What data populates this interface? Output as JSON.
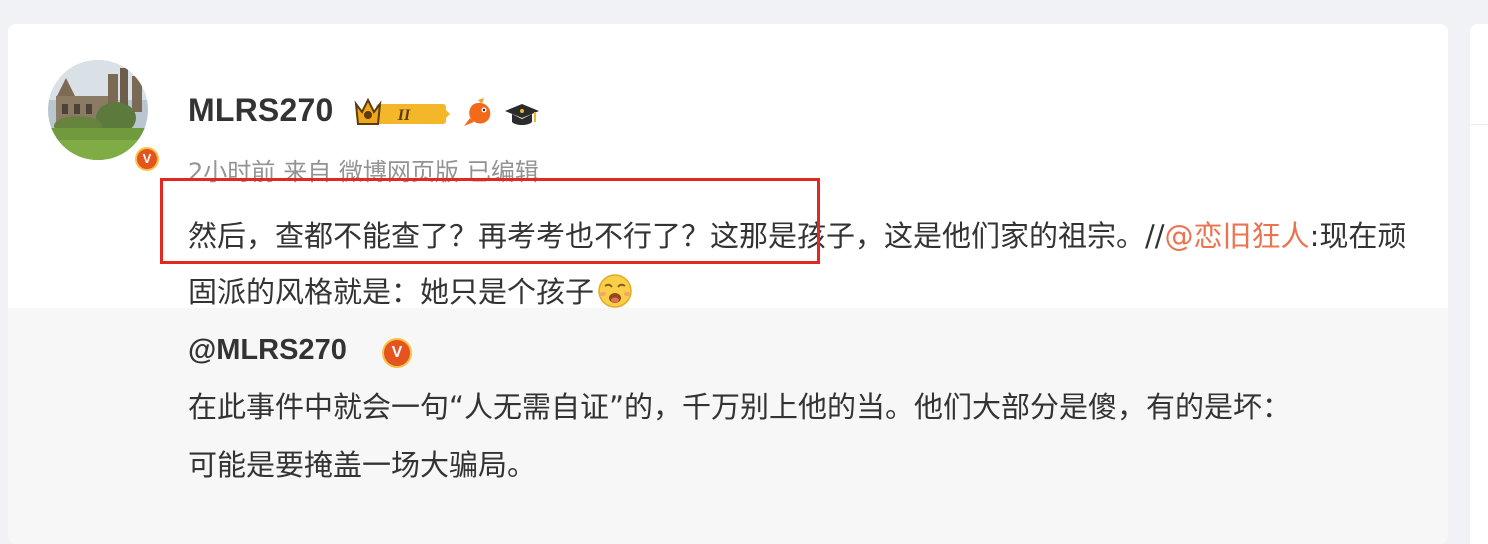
{
  "post": {
    "username": "MLRS270",
    "level_badge": "II",
    "meta": {
      "time": "2小时前",
      "source": "来自 微博网页版",
      "edited": "已编辑"
    },
    "text_before_link": "然后，查都不能查了？再考考也不行了？这那是孩子，这是他们家的祖宗。//",
    "mention": "@恋旧狂人",
    "text_after_link": ":现在顽固派的风格就是：她只是个孩子",
    "verified_mark": "V"
  },
  "repost": {
    "username": "@MLRS270",
    "verified_mark": "V",
    "line1": "在此事件中就会一句“人无需自证”的，千万别上他的当。他们大部分是傻，有的是坏：",
    "line2": "可能是要掩盖一场大骗局。"
  },
  "icons": [
    "crown-level-badge-icon",
    "goldfish-icon",
    "graduation-cap-icon",
    "sad-face-emoji-icon",
    "verified-v-icon"
  ],
  "colors": {
    "link": "#eb7350",
    "highlight": "#e3281f",
    "verified": "#e5531f"
  }
}
